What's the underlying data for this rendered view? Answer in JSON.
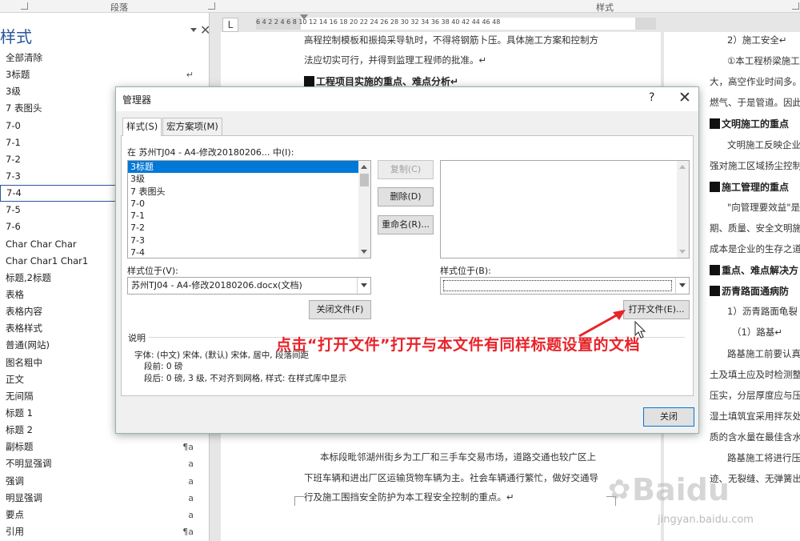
{
  "ribbon": {
    "group_paragraph": "段落",
    "group_styles": "样式"
  },
  "styles_pane": {
    "title": "样式",
    "items": [
      {
        "label": "全部清除",
        "mark": ""
      },
      {
        "label": "3标题",
        "mark": "↵"
      },
      {
        "label": "3级",
        "mark": ""
      },
      {
        "label": "7 表图头",
        "mark": ""
      },
      {
        "label": "7-0",
        "mark": ""
      },
      {
        "label": "7-1",
        "mark": ""
      },
      {
        "label": "7-2",
        "mark": ""
      },
      {
        "label": "7-3",
        "mark": ""
      },
      {
        "label": "7-4",
        "mark": "",
        "selected": true
      },
      {
        "label": "7-5",
        "mark": ""
      },
      {
        "label": "7-6",
        "mark": ""
      },
      {
        "label": "Char Char Char",
        "mark": ""
      },
      {
        "label": "Char Char1 Char1",
        "mark": ""
      },
      {
        "label": "标题,2标题",
        "mark": ""
      },
      {
        "label": "表格",
        "mark": ""
      },
      {
        "label": "表格内容",
        "mark": ""
      },
      {
        "label": "表格样式",
        "mark": ""
      },
      {
        "label": "普通(网站)",
        "mark": ""
      },
      {
        "label": "图名粗中",
        "mark": ""
      },
      {
        "label": "正文",
        "mark": ""
      },
      {
        "label": "无间隔",
        "mark": ""
      },
      {
        "label": "标题 1",
        "mark": ""
      },
      {
        "label": "标题 2",
        "mark": ""
      },
      {
        "label": "副标题",
        "mark": "¶a"
      },
      {
        "label": "不明显强调",
        "mark": "a"
      },
      {
        "label": "强调",
        "mark": "a"
      },
      {
        "label": "明显强调",
        "mark": "a"
      },
      {
        "label": "要点",
        "mark": "a"
      },
      {
        "label": "引用",
        "mark": "¶a"
      }
    ]
  },
  "ruler": {
    "corner": "L",
    "numbers": "6    4    2         2    4    6    8   10   12   14   16   18   20   22   24   26   28   30   32   34   36   38   40   42   44   46   48"
  },
  "document_left": {
    "lines": [
      "高程控制模板和振捣采导轨时，不得将钢筋卜压。具体施工方案和控制方",
      "法应切实可行，并得到监理工程师的批准。↵",
      "工程项目实施的重点、难点分析↵",
      "本标段毗邻湖州街乡为工厂和三手车交易市场，道路交通也较广区上",
      "下班车辆和进出厂区运输货物车辆为主。社会车辆通行繁忙，做好交通导",
      "行及施工围挡安全防护为本工程安全控制的重点。↵"
    ]
  },
  "document_right": {
    "lines": [
      "2）施工安全↵",
      "①本工程桥梁施工",
      "大，高空作业时间多。",
      "燃气、于是管道。因此",
      "文明施工的重点",
      "文明施工反映企业",
      "强对施工区域扬尘控制",
      "施工管理的重点",
      "\"向管理要效益\"是",
      "期、质量、安全文明施",
      "成本是企业的生存之道",
      "重点、难点解决方",
      "沥青路面通病防",
      "1）沥青路面龟裂",
      "（1）路基↵",
      "路基施工前要认真",
      "土及填土应及时检测整",
      "压实，分层厚度应与压",
      "湿土填筑宜采用拌灰处",
      "质的含水量在最佳含水",
      "路基施工将进行压",
      "迹、无裂缝、无弹簧出"
    ]
  },
  "dialog": {
    "title": "管理器",
    "help": "?",
    "tabs": [
      "样式(S)",
      "宏方案项(M)"
    ],
    "left_label": "在 苏州TJ04 - A4-修改20180206... 中(I):",
    "left_list": [
      "3标题",
      "3级",
      "7 表图头",
      "7-0",
      "7-1",
      "7-2",
      "7-3",
      "7-4"
    ],
    "left_location_label": "样式位于(V):",
    "left_location_value": "苏州TJ04 - A4-修改20180206.docx(文档)",
    "right_location_label": "样式位于(B):",
    "right_location_value": "",
    "btn_copy": "复制(C)",
    "btn_delete": "删除(D)",
    "btn_rename": "重命名(R)...",
    "btn_close_file": "关闭文件(F)",
    "btn_open_file": "打开文件(E)...",
    "desc_title": "说明",
    "desc_lines": [
      "字体: (中文) 宋体, (默认) 宋体, 居中, 段落间距",
      "段前: 0 磅",
      "段后: 0 磅, 3 级, 不对齐到网格, 样式: 在样式库中显示"
    ],
    "btn_close": "关闭"
  },
  "annotation": "点击“打开文件”打开与本文件有同样标题设置的文档",
  "watermark": {
    "brand": "Baidu",
    "url": "jingyan.baidu.com"
  },
  "colors": {
    "annotation": "#e8232a",
    "selection": "#0078d7",
    "pane_title": "#2b579a"
  }
}
